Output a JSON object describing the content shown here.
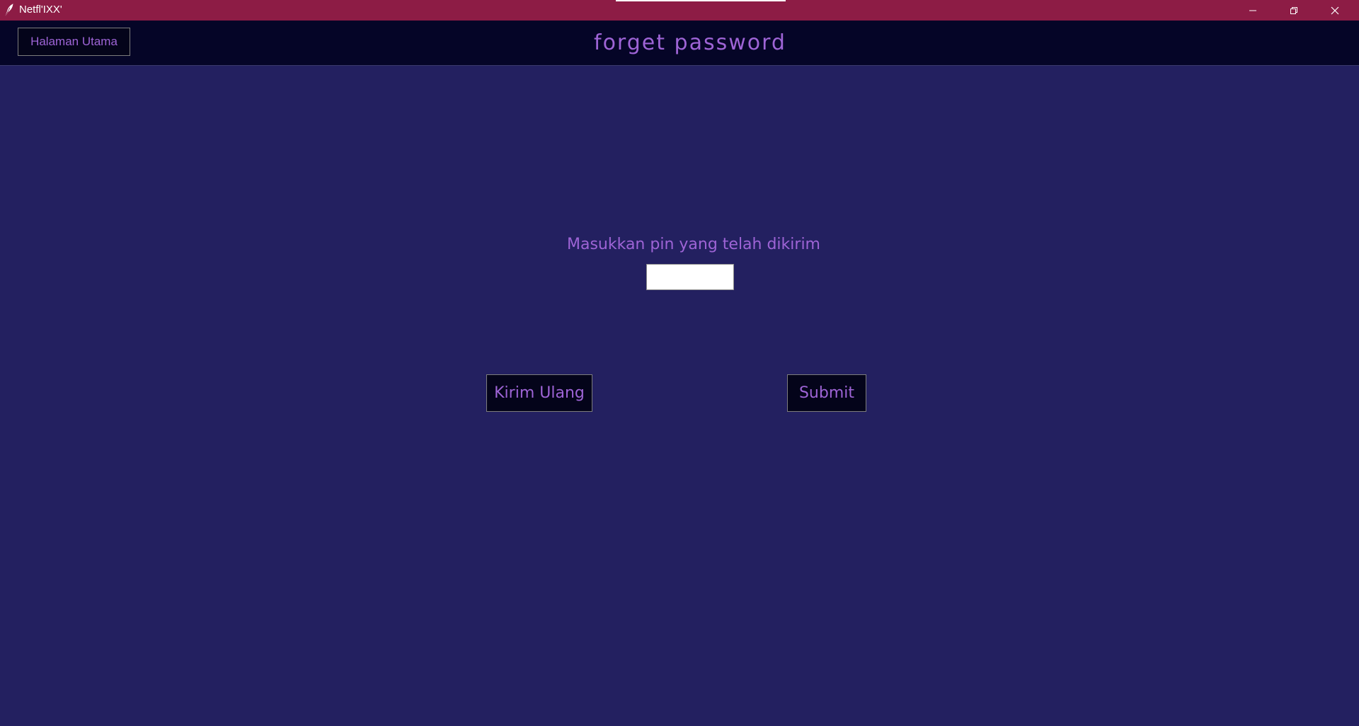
{
  "window": {
    "title": "Netfl'IXX'",
    "controls": {
      "minimize_icon": "minimize-icon",
      "maximize_icon": "restore-icon",
      "close_icon": "close-icon"
    }
  },
  "header": {
    "home_button_label": "Halaman Utama",
    "title": "forget password"
  },
  "main": {
    "prompt": "Masukkan pin yang telah dikirim",
    "pin_input": {
      "value": "",
      "placeholder": ""
    },
    "resend_button_label": "Kirim Ulang",
    "submit_button_label": "Submit"
  },
  "colors": {
    "titlebar": "#8d1c45",
    "header": "#050527",
    "background": "#232060",
    "accent_text": "#9e64d6",
    "button_bg": "#04041a"
  }
}
